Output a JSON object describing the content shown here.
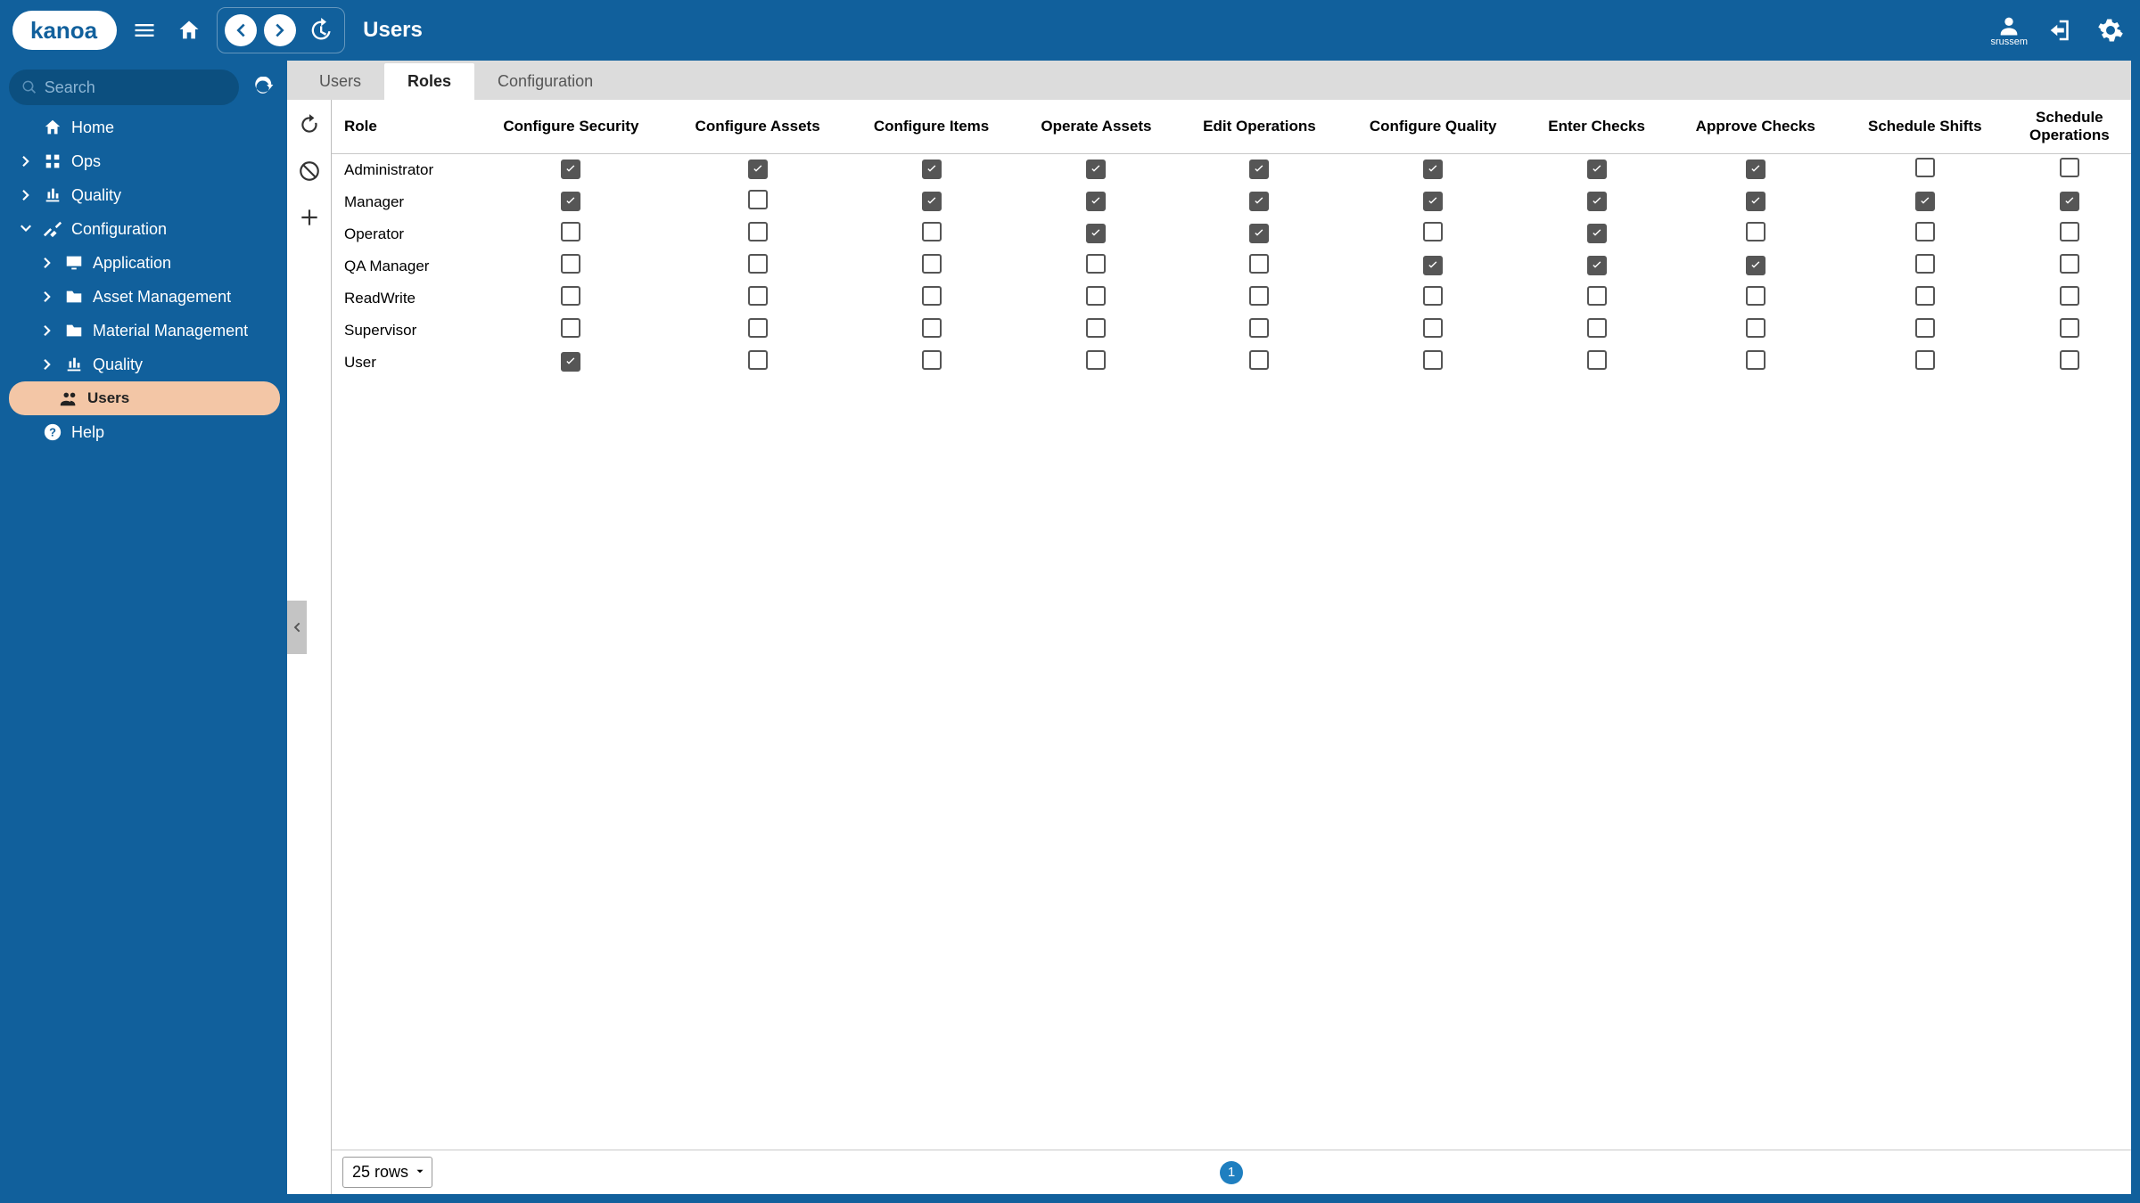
{
  "brand": {
    "name": "kanoa"
  },
  "header": {
    "page_title": "Users",
    "username": "srussem"
  },
  "sidebar": {
    "search_placeholder": "Search",
    "items": [
      {
        "label": "Home"
      },
      {
        "label": "Ops"
      },
      {
        "label": "Quality"
      },
      {
        "label": "Configuration"
      },
      {
        "label": "Help"
      }
    ],
    "config_children": [
      {
        "label": "Application"
      },
      {
        "label": "Asset Management"
      },
      {
        "label": "Material Management"
      },
      {
        "label": "Quality"
      },
      {
        "label": "Users"
      }
    ]
  },
  "tabs": [
    {
      "label": "Users"
    },
    {
      "label": "Roles"
    },
    {
      "label": "Configuration"
    }
  ],
  "active_tab_index": 1,
  "table": {
    "role_header": "Role",
    "columns": [
      "Configure Security",
      "Configure Assets",
      "Configure Items",
      "Operate Assets",
      "Edit Operations",
      "Configure Quality",
      "Enter Checks",
      "Approve Checks",
      "Schedule Shifts",
      "Schedule Operations"
    ],
    "rows": [
      {
        "role": "Administrator",
        "perms": [
          true,
          true,
          true,
          true,
          true,
          true,
          true,
          true,
          false,
          false
        ]
      },
      {
        "role": "Manager",
        "perms": [
          true,
          false,
          true,
          true,
          true,
          true,
          true,
          true,
          true,
          true
        ]
      },
      {
        "role": "Operator",
        "perms": [
          false,
          false,
          false,
          true,
          true,
          false,
          true,
          false,
          false,
          false
        ]
      },
      {
        "role": "QA Manager",
        "perms": [
          false,
          false,
          false,
          false,
          false,
          true,
          true,
          true,
          false,
          false
        ]
      },
      {
        "role": "ReadWrite",
        "perms": [
          false,
          false,
          false,
          false,
          false,
          false,
          false,
          false,
          false,
          false
        ]
      },
      {
        "role": "Supervisor",
        "perms": [
          false,
          false,
          false,
          false,
          false,
          false,
          false,
          false,
          false,
          false
        ]
      },
      {
        "role": "User",
        "perms": [
          true,
          false,
          false,
          false,
          false,
          false,
          false,
          false,
          false,
          false
        ]
      }
    ],
    "rows_selector": "25 rows",
    "page": "1"
  }
}
